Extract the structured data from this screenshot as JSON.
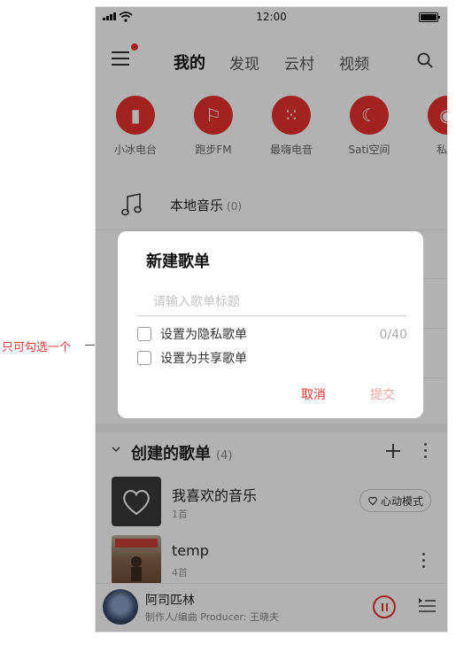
{
  "annotation": {
    "text": "只可勾选一个"
  },
  "status_bar": {
    "time": "12:00"
  },
  "top_nav": {
    "tabs": [
      "我的",
      "发现",
      "云村",
      "视频"
    ]
  },
  "shortcuts": [
    "小冰电台",
    "跑步FM",
    "最嗨电音",
    "Sati空间",
    "私人"
  ],
  "local_music": {
    "label": "本地音乐",
    "count": "(0)"
  },
  "created_playlists": {
    "title": "创建的歌单",
    "count": "(4)",
    "items": [
      {
        "name": "我喜欢的音乐",
        "sub": "1首",
        "action": "心动模式"
      },
      {
        "name": "temp",
        "sub": "4首"
      }
    ]
  },
  "player": {
    "title": "阿司匹林",
    "subtitle": "制作人/编曲 Producer: 王晓夫"
  },
  "dialog": {
    "title": "新建歌单",
    "placeholder": "请输入歌单标题",
    "counter": "0/40",
    "options": [
      "设置为隐私歌单",
      "设置为共享歌单"
    ],
    "cancel": "取消",
    "submit": "提交"
  },
  "colors": {
    "accent": "#e8322e",
    "submit_disabled": "#f2a3a0"
  }
}
